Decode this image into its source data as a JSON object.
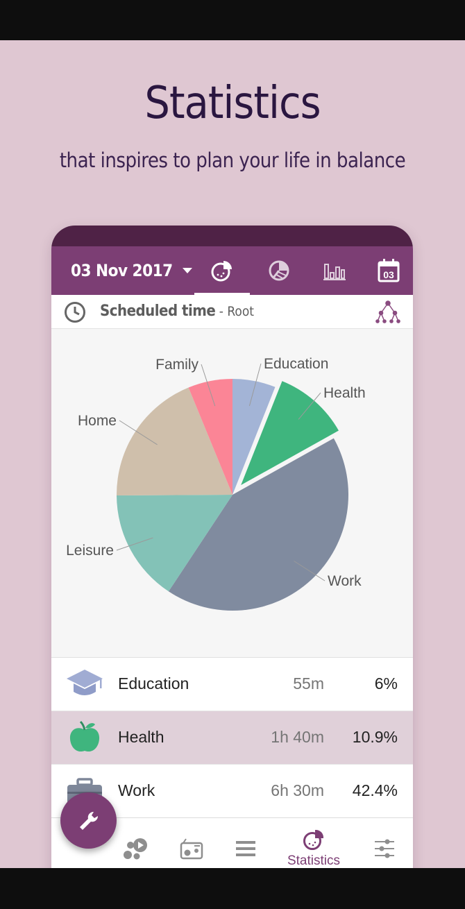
{
  "promo": {
    "title": "Statistics",
    "subtitle": "that inspires to plan your life in balance"
  },
  "app_bar": {
    "date": "03 Nov 2017",
    "calendar_day": "03",
    "tabs": [
      "pie-chart-icon",
      "pie-segments-icon",
      "bar-chart-icon",
      "calendar-icon"
    ],
    "active_tab": 0
  },
  "scheduled": {
    "title": "Scheduled time",
    "separator": " - ",
    "scope": "Root"
  },
  "chart_data": {
    "type": "pie",
    "categories": [
      "Education",
      "Health",
      "Work",
      "Leisure",
      "Home",
      "Family"
    ],
    "values": [
      6,
      10.9,
      42.4,
      15.6,
      18.9,
      6.2
    ],
    "exploded": "Health",
    "colors": [
      "#a3b4d6",
      "#3fb57e",
      "#808b9f",
      "#83c2b7",
      "#cfbfab",
      "#fb8596"
    ]
  },
  "list": [
    {
      "name": "Education",
      "duration": "55m",
      "percent": "6%",
      "icon": "graduation-cap-icon",
      "color": "#a0acd3"
    },
    {
      "name": "Health",
      "duration": "1h 40m",
      "percent": "10.9%",
      "icon": "apple-icon",
      "color": "#3fb57e",
      "selected": true
    },
    {
      "name": "Work",
      "duration": "6h 30m",
      "percent": "42.4%",
      "icon": "briefcase-icon",
      "color": "#7e8799"
    }
  ],
  "bottom_nav": {
    "items": [
      "bubbles-icon",
      "radio-icon",
      "list-icon",
      "statistics-icon",
      "sliders-icon"
    ],
    "active_label": "Statistics"
  },
  "fab_icon": "wrench-icon"
}
